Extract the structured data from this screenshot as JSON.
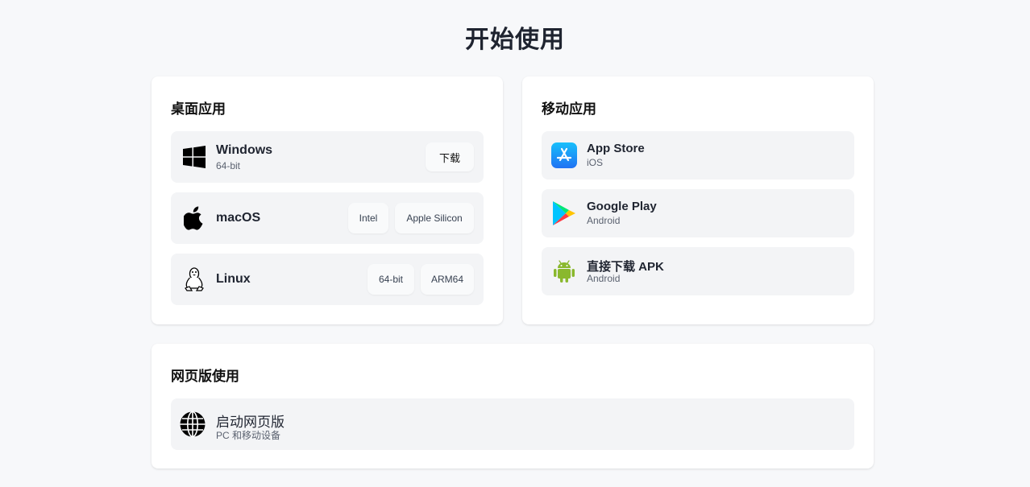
{
  "page": {
    "title": "开始使用"
  },
  "desktop": {
    "title": "桌面应用",
    "windows": {
      "name": "Windows",
      "sub": "64-bit",
      "download": "下载",
      "icon": "windows-logo-icon"
    },
    "macos": {
      "name": "macOS",
      "intel": "Intel",
      "apple_silicon": "Apple Silicon",
      "icon": "apple-logo-icon"
    },
    "linux": {
      "name": "Linux",
      "x64": "64-bit",
      "arm64": "ARM64",
      "icon": "linux-penguin-icon"
    }
  },
  "mobile": {
    "title": "移动应用",
    "items": [
      {
        "name": "App Store",
        "sub": "iOS",
        "icon": "app-store-icon"
      },
      {
        "name": "Google Play",
        "sub": "Android",
        "icon": "google-play-icon"
      },
      {
        "name": "直接下载 APK",
        "sub": "Android",
        "icon": "android-icon"
      }
    ]
  },
  "web": {
    "title": "网页版使用",
    "launch": {
      "name": "启动网页版",
      "sub": "PC 和移动设备",
      "icon": "globe-icon"
    }
  },
  "colors": {
    "background": "#f7f8fa",
    "card": "#ffffff",
    "row": "#f3f4f6",
    "app_store_blue": "#1a8cf5",
    "android_green": "#8ab82e"
  }
}
